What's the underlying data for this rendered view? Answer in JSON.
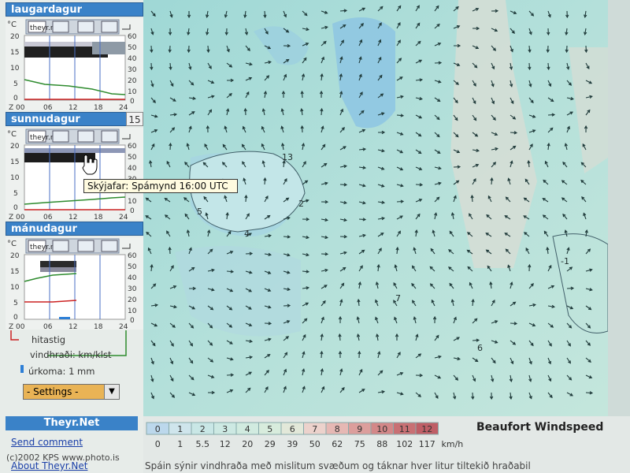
{
  "days": [
    {
      "title": "laugardagur",
      "badge": "",
      "ticks_left": [
        "20",
        "15",
        "10",
        "5",
        "0"
      ],
      "ticks_right": [
        "60",
        "50",
        "40",
        "30",
        "20",
        "10",
        "0"
      ],
      "x_labels": [
        "Z 00",
        "06",
        "12",
        "18",
        "24"
      ],
      "unit_c": "°C"
    },
    {
      "title": "sunnudagur",
      "badge": "15",
      "ticks_left": [
        "20",
        "15",
        "10",
        "5",
        "0"
      ],
      "ticks_right": [
        "60",
        "50",
        "40",
        "30",
        "20",
        "10",
        "0"
      ],
      "x_labels": [
        "Z 00",
        "06",
        "12",
        "18",
        "24"
      ],
      "unit_c": "°C"
    },
    {
      "title": "mánudagur",
      "badge": "",
      "ticks_left": [
        "20",
        "15",
        "10",
        "5",
        "0"
      ],
      "ticks_right": [
        "60",
        "50",
        "40",
        "30",
        "20",
        "10",
        "0"
      ],
      "x_labels": [
        "Z 00",
        "06",
        "12",
        "18",
        "24"
      ],
      "unit_c": "°C"
    }
  ],
  "logo_text": "theyr.net",
  "tooltip": "Skýjafar: Spámynd 16:00 UTC",
  "legend": {
    "temp": "hitastig",
    "wind": "vindhraði: km/klst",
    "rain": "úrkoma: 1 mm"
  },
  "settings": {
    "label": "- Settings -"
  },
  "brand": "Theyr.Net",
  "links": {
    "send": "Send comment",
    "about": "About Theyr.Net"
  },
  "watermark": "(c)2002 KPS www.photo.is",
  "map": {
    "labels": [
      "13",
      "2",
      "5",
      "4",
      "7",
      "-1",
      "6"
    ]
  },
  "scale": {
    "title": "Beaufort Windspeed",
    "beaufort": [
      "0",
      "1",
      "2",
      "3",
      "4",
      "5",
      "6",
      "7",
      "8",
      "9",
      "10",
      "11",
      "12"
    ],
    "kmh": [
      "0",
      "1",
      "5.5",
      "12",
      "20",
      "29",
      "39",
      "50",
      "62",
      "75",
      "88",
      "102",
      "117"
    ],
    "unit": "km/h",
    "colors": [
      "#bcd8ec",
      "#cfe5ec",
      "#c9e7e6",
      "#cde9e3",
      "#d1ebe0",
      "#d8ecdd",
      "#e2e8d9",
      "#ecd2cc",
      "#e6b8b4",
      "#dc9e9c",
      "#d38788",
      "#c87074",
      "#bf5e66"
    ],
    "caption": "Spáin sýnir vindhraða með mislitum svæðum og táknar hver litur tiltekið hraðabil"
  },
  "colors": {
    "accent": "#3a82c8"
  }
}
